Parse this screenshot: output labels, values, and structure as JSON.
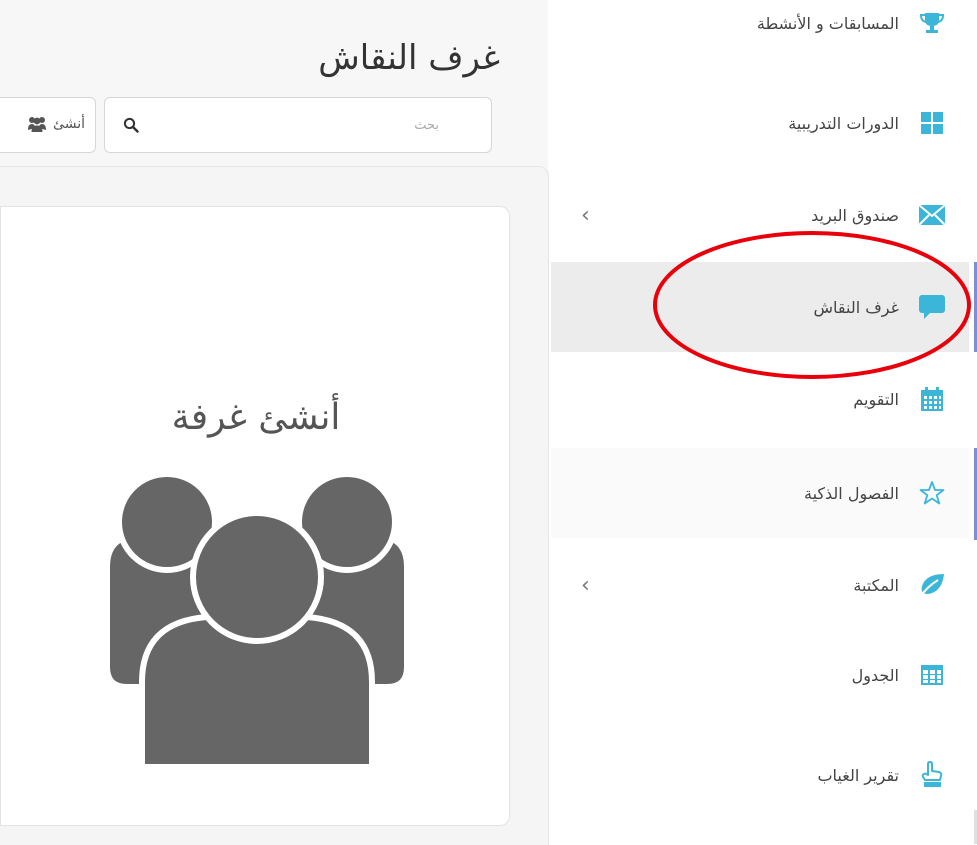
{
  "page": {
    "title": "غرف النقاش"
  },
  "search": {
    "placeholder": "بحث"
  },
  "create_button": {
    "label": "أنشئ"
  },
  "card": {
    "title": "أنشئ غرفة"
  },
  "sidebar": {
    "items": [
      {
        "label": "المسابقات و الأنشطة",
        "icon": "trophy-icon"
      },
      {
        "label": "الدورات التدريبية",
        "icon": "tiles-icon"
      },
      {
        "label": "صندوق البريد",
        "icon": "envelope-icon",
        "has_submenu": true
      },
      {
        "label": "غرف النقاش",
        "icon": "chat-bubble-icon",
        "active": true
      },
      {
        "label": "التقويم",
        "icon": "calendar-icon"
      },
      {
        "label": "الفصول الذكية",
        "icon": "star-icon"
      },
      {
        "label": "المكتبة",
        "icon": "leaf-icon",
        "has_submenu": true
      },
      {
        "label": "الجدول",
        "icon": "table-icon"
      },
      {
        "label": "تقرير الغياب",
        "icon": "hand-pointer-icon"
      }
    ]
  },
  "colors": {
    "accent": "#3bb6d8",
    "active_bg": "#ececec",
    "indicator": "#7f8ed0",
    "annotation": "#e8000b"
  }
}
